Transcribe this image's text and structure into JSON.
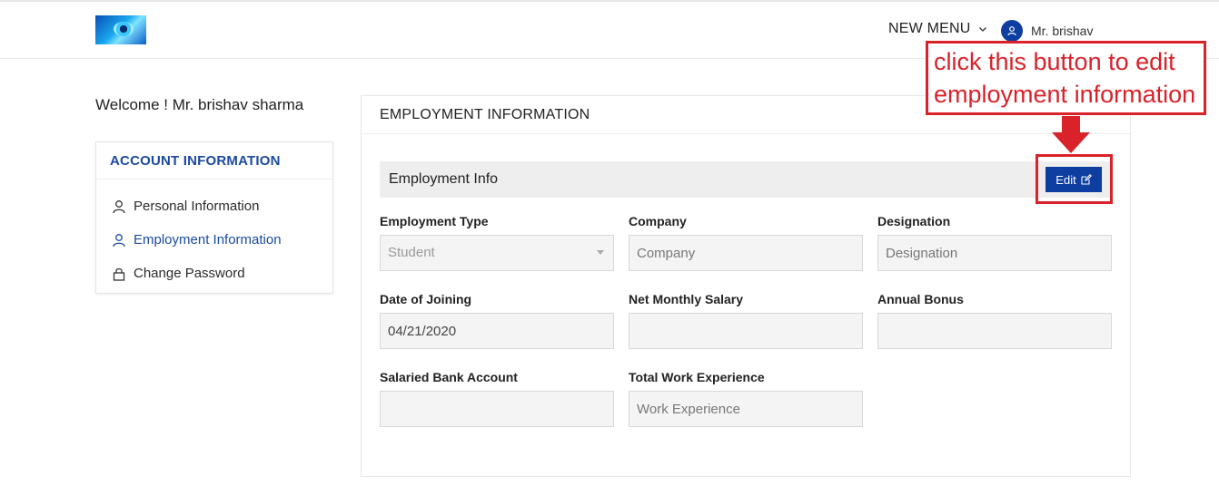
{
  "header": {
    "logo": "logo-image",
    "nav_menu_label": "NEW MENU",
    "user_name": "Mr. brishav"
  },
  "welcome_text": "Welcome ! Mr. brishav sharma",
  "sidebar": {
    "title": "ACCOUNT INFORMATION",
    "items": [
      {
        "label": "Personal Information",
        "icon": "user-icon",
        "active": false
      },
      {
        "label": "Employment Information",
        "icon": "user-icon",
        "active": true
      },
      {
        "label": "Change Password",
        "icon": "lock-icon",
        "active": false
      }
    ]
  },
  "main": {
    "title": "EMPLOYMENT INFORMATION",
    "section_title": "Employment Info",
    "edit_label": "Edit",
    "fields": {
      "employment_type": {
        "label": "Employment Type",
        "value": "Student"
      },
      "company": {
        "label": "Company",
        "value": "",
        "placeholder": "Company"
      },
      "designation": {
        "label": "Designation",
        "value": "",
        "placeholder": "Designation"
      },
      "date_of_joining": {
        "label": "Date of Joining",
        "value": "04/21/2020"
      },
      "net_monthly_salary": {
        "label": "Net Monthly Salary",
        "value": ""
      },
      "annual_bonus": {
        "label": "Annual Bonus",
        "value": ""
      },
      "salaried_bank_account": {
        "label": "Salaried Bank Account",
        "value": ""
      },
      "total_work_experience": {
        "label": "Total Work Experience",
        "value": "",
        "placeholder": "Work Experience"
      }
    }
  },
  "annotation": {
    "text_line1": "click this button to edit",
    "text_line2": "employment information",
    "color": "#d9222a"
  },
  "colors": {
    "brand_blue": "#0d3ea0",
    "link_blue": "#1b4aa0"
  }
}
